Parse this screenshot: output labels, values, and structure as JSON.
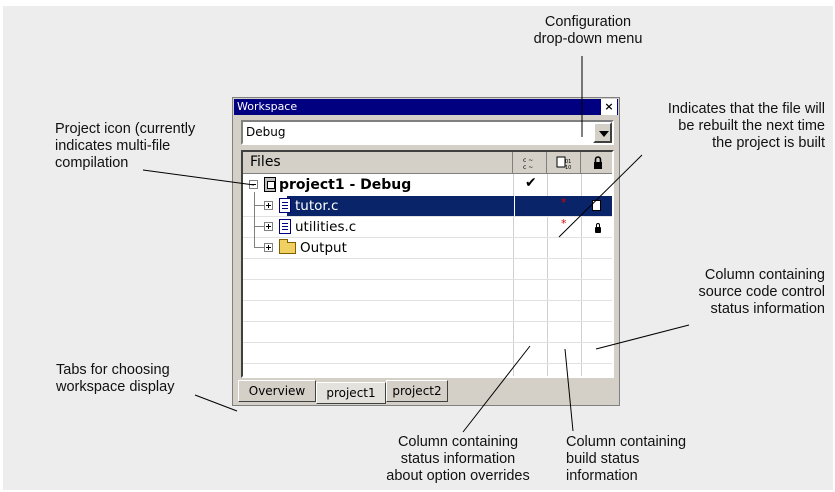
{
  "window": {
    "title": "Workspace",
    "close_glyph": "×",
    "configuration": "Debug"
  },
  "tree": {
    "header": {
      "files_label": "Files",
      "col_icons": [
        "option-override-icon",
        "build-status-icon",
        "lock-icon"
      ]
    },
    "rows": [
      {
        "label": "project1 - Debug",
        "kind": "project",
        "bold": true,
        "expander": "minus",
        "option_check": "✔"
      },
      {
        "label": "tutor.c",
        "kind": "file",
        "selected": true,
        "expander": "plus",
        "build_mark": "*",
        "scc": "document"
      },
      {
        "label": "utilities.c",
        "kind": "file",
        "expander": "plus",
        "build_mark": "*",
        "scc": "lock"
      },
      {
        "label": "Output",
        "kind": "folder",
        "expander": "plus"
      }
    ]
  },
  "tabs": [
    {
      "label": "Overview"
    },
    {
      "label": "project1",
      "active": true
    },
    {
      "label": "project2"
    }
  ],
  "callouts": {
    "config": "Configuration\ndrop-down menu",
    "project_icon": "Project icon (currently\nindicates multi-file\ncompilation",
    "rebuilt": "Indicates that the file will\nbe rebuilt the next time\nthe project is built",
    "scc": "Column containing\nsource code control\nstatus information",
    "tabs": "Tabs for choosing\nworkspace display",
    "option_overrides": "Column containing\nstatus information\nabout option overrides",
    "build_status": "Column containing\nbuild status\ninformation"
  }
}
